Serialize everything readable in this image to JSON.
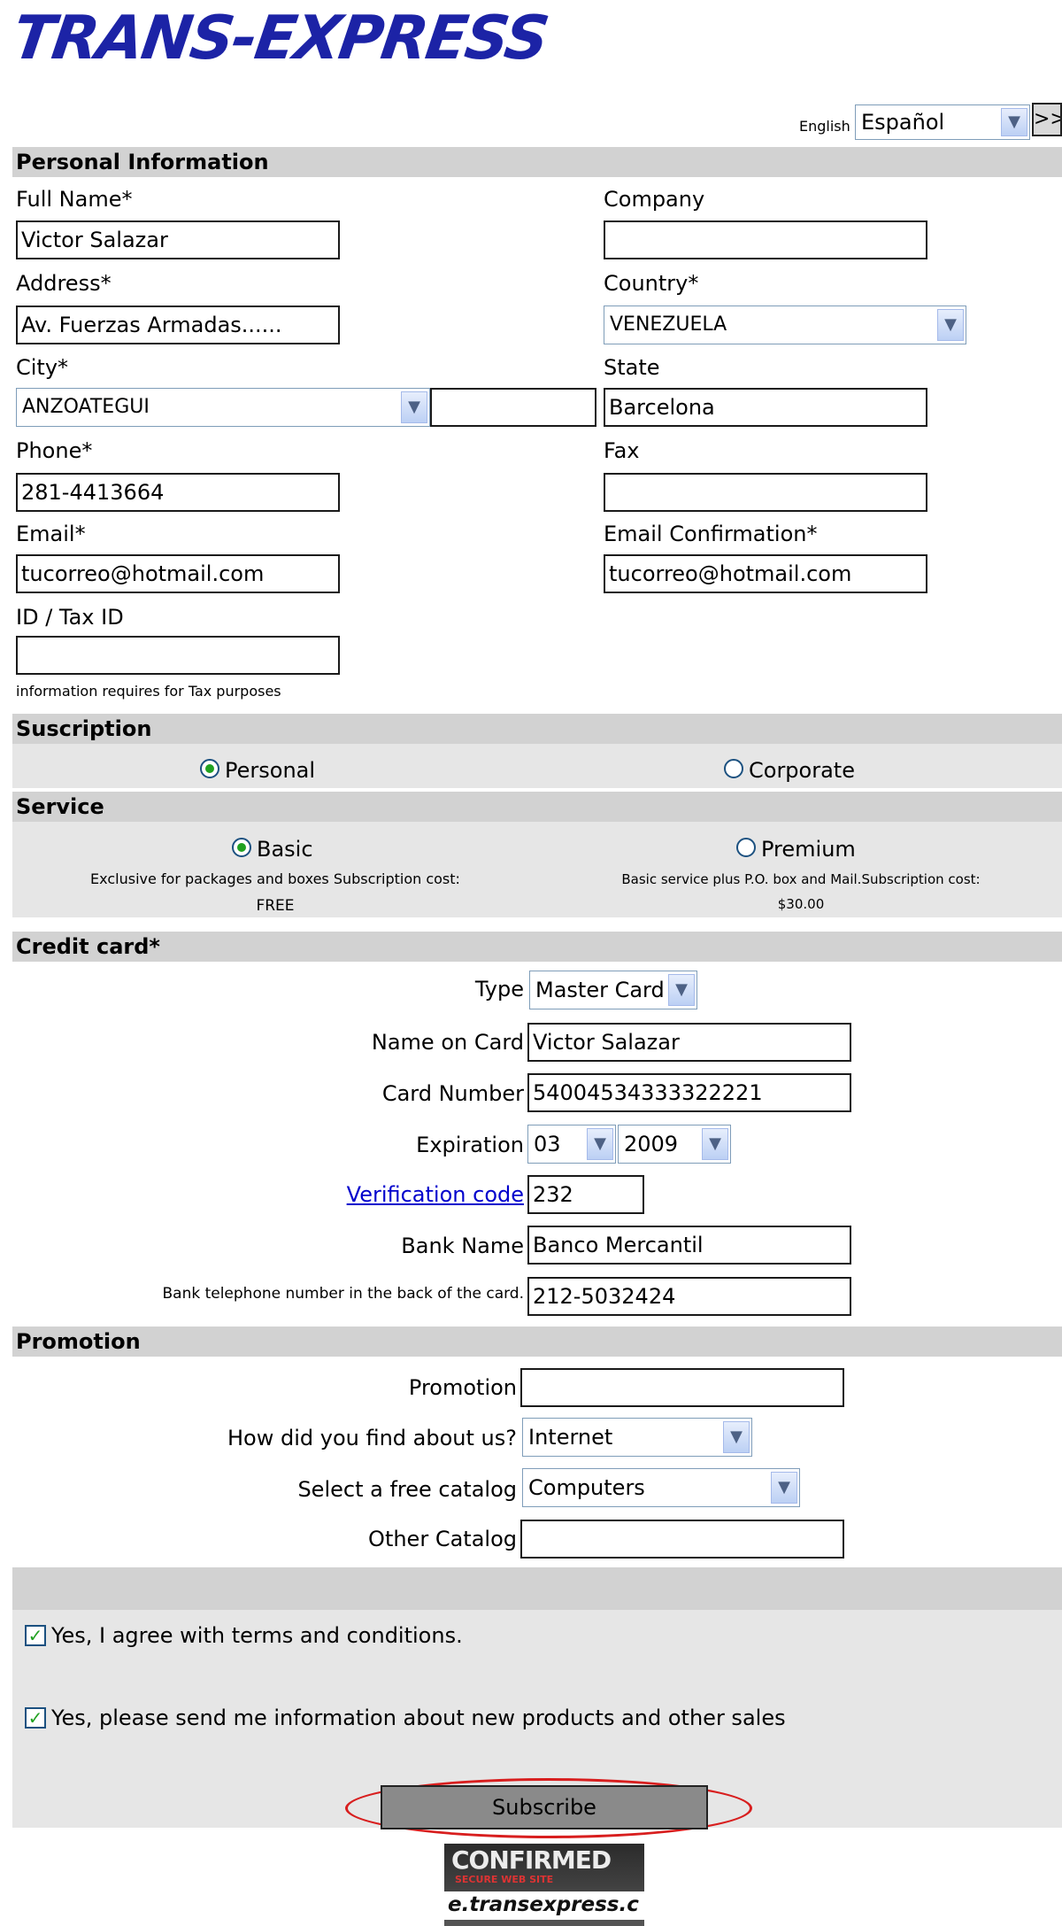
{
  "brand": {
    "logo_text": "TRANS-EXPRESS"
  },
  "language": {
    "label": "English",
    "selected": "Español",
    "go_label": ">>"
  },
  "personal": {
    "heading": "Personal Information",
    "full_name_label": "Full Name*",
    "full_name_value": "Victor Salazar",
    "company_label": "Company",
    "company_value": "",
    "address_label": "Address*",
    "address_value": "Av. Fuerzas Armadas......",
    "country_label": "Country*",
    "country_value": "VENEZUELA",
    "city_label": "City*",
    "city_value": "ANZOATEGUI",
    "city_other_value": "",
    "state_label": "State",
    "state_value": "Barcelona",
    "phone_label": "Phone*",
    "phone_value": "281-4413664",
    "fax_label": "Fax",
    "fax_value": "",
    "email_label": "Email*",
    "email_value": "tucorreo@hotmail.com",
    "email_confirm_label": "Email Confirmation*",
    "email_confirm_value": "tucorreo@hotmail.com",
    "taxid_label": "ID / Tax ID",
    "taxid_value": "",
    "taxid_note": "information requires for Tax purposes"
  },
  "subscription": {
    "heading": "Suscription",
    "options": [
      {
        "label": "Personal",
        "checked": true
      },
      {
        "label": "Corporate",
        "checked": false
      }
    ]
  },
  "service": {
    "heading": "Service",
    "basic_label": "Basic",
    "basic_desc": "Exclusive for packages and boxes Subscription cost:",
    "basic_price": "FREE",
    "premium_label": "Premium",
    "premium_desc": "Basic service plus P.O. box and Mail.Subscription cost:",
    "premium_price": "$30.00",
    "selected": "Basic"
  },
  "credit": {
    "heading": "Credit card*",
    "type_label": "Type",
    "type_value": "Master Card",
    "name_label": "Name on Card",
    "name_value": "Victor Salazar",
    "number_label": "Card Number",
    "number_value": "54004534333322221",
    "expiration_label": "Expiration",
    "exp_month": "03",
    "exp_year": "2009",
    "verification_label": "Verification code",
    "verification_value": "232",
    "bank_label": "Bank Name",
    "bank_value": "Banco Mercantil",
    "bank_phone_label": "Bank telephone number in the back of the card.",
    "bank_phone_value": "212-5032424"
  },
  "promotion": {
    "heading": "Promotion",
    "promo_label": "Promotion",
    "promo_value": "",
    "find_label": "How did you find about us?",
    "find_value": "Internet",
    "catalog_label": "Select a free catalog",
    "catalog_value": "Computers",
    "other_label": "Other Catalog",
    "other_value": ""
  },
  "agreements": {
    "terms_label": "Yes, I agree with terms and conditions.",
    "terms_checked": true,
    "news_label": "Yes, please send me information about new products and other sales",
    "news_checked": true
  },
  "submit": {
    "label": "Subscribe"
  },
  "badge": {
    "line1": "CONFIRMED",
    "line2": "SECURE WEB SITE",
    "url": "e.transexpress.c"
  }
}
